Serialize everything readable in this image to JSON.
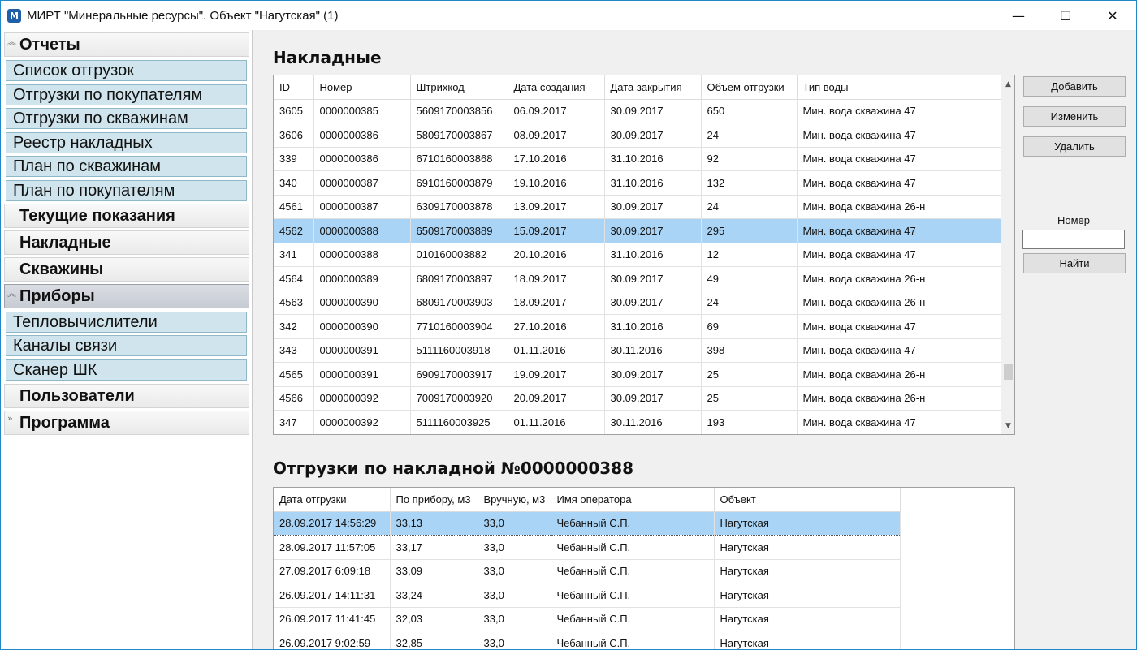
{
  "window": {
    "title": "МИРТ \"Минеральные ресурсы\". Объект \"Нагутская\" (1)",
    "icon_text": "M",
    "controls": {
      "minimize": "—",
      "maximize": "☐",
      "close": "✕"
    }
  },
  "nav": {
    "otchety": {
      "label": "Отчеты",
      "items": [
        "Список отгрузок",
        "Отгрузки по покупателям",
        "Отгрузки по скважинам",
        "Реестр накладных",
        "План по скважинам",
        "План по покупателям"
      ]
    },
    "tekushchie": "Текущие показания",
    "nakladnye": "Накладные",
    "skvazhiny": "Скважины",
    "pribory": {
      "label": "Приборы",
      "items": [
        "Тепловычислители",
        "Каналы связи",
        "Сканер ШК"
      ]
    },
    "polzovateli": "Пользователи",
    "programma": "Программа"
  },
  "invoices": {
    "title": "Накладные",
    "columns": [
      "ID",
      "Номер",
      "Штрихкод",
      "Дата создания",
      "Дата закрытия",
      "Объем отгрузки",
      "Тип воды"
    ],
    "rows": [
      [
        "3605",
        "0000000385",
        "5609170003856",
        "06.09.2017",
        "30.09.2017",
        "650",
        "Мин. вода скважина 47"
      ],
      [
        "3606",
        "0000000386",
        "5809170003867",
        "08.09.2017",
        "30.09.2017",
        "24",
        "Мин. вода скважина 47"
      ],
      [
        "339",
        "0000000386",
        "6710160003868",
        "17.10.2016",
        "31.10.2016",
        "92",
        "Мин. вода скважина 47"
      ],
      [
        "340",
        "0000000387",
        "6910160003879",
        "19.10.2016",
        "31.10.2016",
        "132",
        "Мин. вода скважина 47"
      ],
      [
        "4561",
        "0000000387",
        "6309170003878",
        "13.09.2017",
        "30.09.2017",
        "24",
        "Мин. вода скважина 26-н"
      ],
      [
        "4562",
        "0000000388",
        "6509170003889",
        "15.09.2017",
        "30.09.2017",
        "295",
        "Мин. вода скважина 47"
      ],
      [
        "341",
        "0000000388",
        "010160003882",
        "20.10.2016",
        "31.10.2016",
        "12",
        "Мин. вода скважина 47"
      ],
      [
        "4564",
        "0000000389",
        "6809170003897",
        "18.09.2017",
        "30.09.2017",
        "49",
        "Мин. вода скважина 26-н"
      ],
      [
        "4563",
        "0000000390",
        "6809170003903",
        "18.09.2017",
        "30.09.2017",
        "24",
        "Мин. вода скважина 26-н"
      ],
      [
        "342",
        "0000000390",
        "7710160003904",
        "27.10.2016",
        "31.10.2016",
        "69",
        "Мин. вода скважина 47"
      ],
      [
        "343",
        "0000000391",
        "5111160003918",
        "01.11.2016",
        "30.11.2016",
        "398",
        "Мин. вода скважина 47"
      ],
      [
        "4565",
        "0000000391",
        "6909170003917",
        "19.09.2017",
        "30.09.2017",
        "25",
        "Мин. вода скважина 26-н"
      ],
      [
        "4566",
        "0000000392",
        "7009170003920",
        "20.09.2017",
        "30.09.2017",
        "25",
        "Мин. вода скважина 26-н"
      ],
      [
        "347",
        "0000000392",
        "5111160003925",
        "01.11.2016",
        "30.11.2016",
        "193",
        "Мин. вода скважина 47"
      ]
    ],
    "selected_index": 5
  },
  "actions": {
    "add": "Добавить",
    "edit": "Изменить",
    "delete": "Удалить",
    "search_label": "Номер",
    "search_value": "",
    "find": "Найти"
  },
  "shipments": {
    "title": "Отгрузки по накладной №0000000388",
    "columns": [
      "Дата отгрузки",
      "По прибору, м3",
      "Вручную, м3",
      "Имя оператора",
      "Объект"
    ],
    "rows": [
      [
        "28.09.2017 14:56:29",
        "33,13",
        "33,0",
        "Чебанный С.П.",
        "Нагутская"
      ],
      [
        "28.09.2017 11:57:05",
        "33,17",
        "33,0",
        "Чебанный С.П.",
        "Нагутская"
      ],
      [
        "27.09.2017 6:09:18",
        "33,09",
        "33,0",
        "Чебанный С.П.",
        "Нагутская"
      ],
      [
        "26.09.2017 14:11:31",
        "33,24",
        "33,0",
        "Чебанный С.П.",
        "Нагутская"
      ],
      [
        "26.09.2017 11:41:45",
        "32,03",
        "33,0",
        "Чебанный С.П.",
        "Нагутская"
      ],
      [
        "26.09.2017 9:02:59",
        "32,85",
        "33,0",
        "Чебанный С.П.",
        "Нагутская"
      ]
    ],
    "selected_index": 0
  },
  "colors": {
    "accent_border": "#1e88c9",
    "selection": "#a9d4f5",
    "nav_item_bg": "#cfe4ec"
  }
}
